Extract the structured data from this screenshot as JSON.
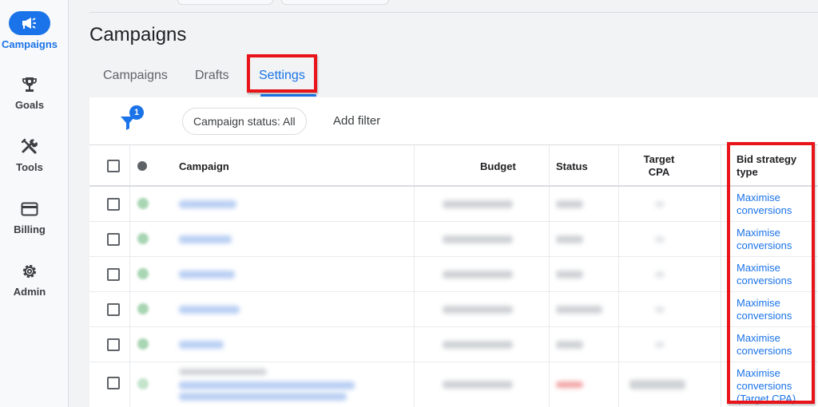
{
  "sidebar": {
    "items": [
      {
        "label": "Campaigns",
        "icon": "megaphone-icon",
        "active": true
      },
      {
        "label": "Goals",
        "icon": "trophy-icon",
        "active": false
      },
      {
        "label": "Tools",
        "icon": "tools-icon",
        "active": false
      },
      {
        "label": "Billing",
        "icon": "credit-card-icon",
        "active": false
      },
      {
        "label": "Admin",
        "icon": "gear-icon",
        "active": false
      }
    ]
  },
  "page": {
    "title": "Campaigns"
  },
  "tabs": [
    {
      "label": "Campaigns",
      "active": false
    },
    {
      "label": "Drafts",
      "active": false
    },
    {
      "label": "Settings",
      "active": true
    }
  ],
  "filters": {
    "badge_count": "1",
    "status_chip": "Campaign status: All",
    "add_filter": "Add filter"
  },
  "table": {
    "headers": {
      "campaign": "Campaign",
      "budget": "Budget",
      "status": "Status",
      "target_cpa_line1": "Target",
      "target_cpa_line2": "CPA",
      "bid_line1": "Bid strategy",
      "bid_line2": "type"
    },
    "rows": [
      {
        "bid_line1": "Maximise",
        "bid_line2": "conversions",
        "bid_line3": ""
      },
      {
        "bid_line1": "Maximise",
        "bid_line2": "conversions",
        "bid_line3": ""
      },
      {
        "bid_line1": "Maximise",
        "bid_line2": "conversions",
        "bid_line3": ""
      },
      {
        "bid_line1": "Maximise",
        "bid_line2": "conversions",
        "bid_line3": ""
      },
      {
        "bid_line1": "Maximise",
        "bid_line2": "conversions",
        "bid_line3": ""
      },
      {
        "bid_line1": "Maximise",
        "bid_line2": "conversions",
        "bid_line3": "(Target CPA)"
      }
    ]
  },
  "colors": {
    "accent": "#1a73e8",
    "highlight": "#e8141a",
    "status_enabled": "#a8d5b3"
  }
}
